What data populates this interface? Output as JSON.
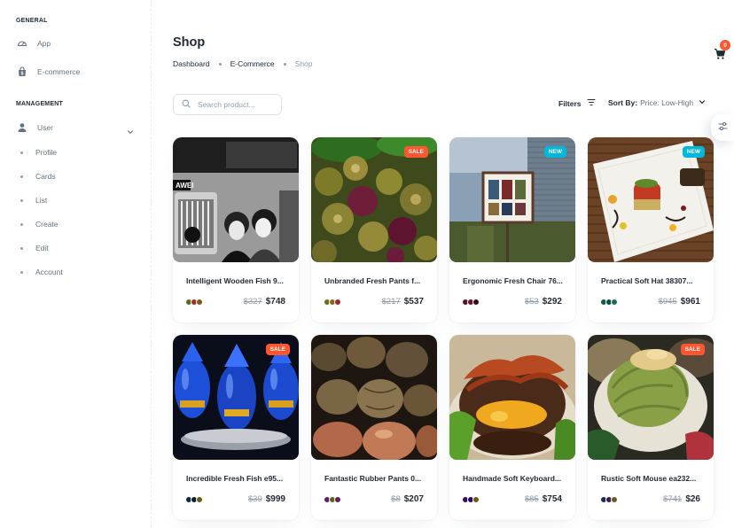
{
  "sidebar": {
    "general_header": "GENERAL",
    "management_header": "MANAGEMENT",
    "items": [
      {
        "label": "App",
        "icon": "dashboard-icon"
      },
      {
        "label": "E-commerce",
        "icon": "shopping-bag-icon"
      },
      {
        "label": "User",
        "icon": "user-icon"
      }
    ],
    "user_subitems": [
      "Profile",
      "Cards",
      "List",
      "Create",
      "Edit",
      "Account"
    ]
  },
  "page": {
    "title": "Shop",
    "breadcrumb": [
      "Dashboard",
      "E-Commerce",
      "Shop"
    ]
  },
  "toolbar": {
    "search_placeholder": "Search product...",
    "filters_label": "Filters",
    "sort_key": "Sort By:",
    "sort_value": "Price: Low-High"
  },
  "cart": {
    "count": "0"
  },
  "products": [
    {
      "name": "Intelligent Wooden Fish 9...",
      "old_price": "$327",
      "price": "$748",
      "label": "",
      "swatches": [
        "#5a6c1b",
        "#b5231f",
        "#7a5c0f"
      ]
    },
    {
      "name": "Unbranded Fresh Pants f...",
      "old_price": "$217",
      "price": "$537",
      "label": "SALE",
      "swatches": [
        "#6b6f1e",
        "#8a6a18",
        "#9a2a2a"
      ]
    },
    {
      "name": "Ergonomic Fresh Chair 76...",
      "old_price": "$53",
      "price": "$292",
      "label": "NEW",
      "swatches": [
        "#5b0f24",
        "#6d0f2a",
        "#3a0a1c"
      ]
    },
    {
      "name": "Practical Soft Hat 38307...",
      "old_price": "$945",
      "price": "$961",
      "label": "NEW",
      "swatches": [
        "#0f5a4a",
        "#0e4f44",
        "#1d6b58"
      ]
    },
    {
      "name": "Incredible Fresh Fish e95...",
      "old_price": "$39",
      "price": "$999",
      "label": "SALE",
      "swatches": [
        "#0d2a4a",
        "#0b1f3a",
        "#6b5a1a"
      ]
    },
    {
      "name": "Fantastic Rubber Pants 0...",
      "old_price": "$8",
      "price": "$207",
      "label": "",
      "swatches": [
        "#6a1a6a",
        "#5a6a1a",
        "#6a1a5a"
      ]
    },
    {
      "name": "Handmade Soft Keyboard...",
      "old_price": "$85",
      "price": "$754",
      "label": "",
      "swatches": [
        "#3a0a6a",
        "#2a0a5a",
        "#6a5a1a"
      ]
    },
    {
      "name": "Rustic Soft Mouse ea232...",
      "old_price": "$741",
      "price": "$26",
      "label": "SALE",
      "swatches": [
        "#1a2a5a",
        "#3a1a4a",
        "#6a5a1a"
      ]
    }
  ]
}
